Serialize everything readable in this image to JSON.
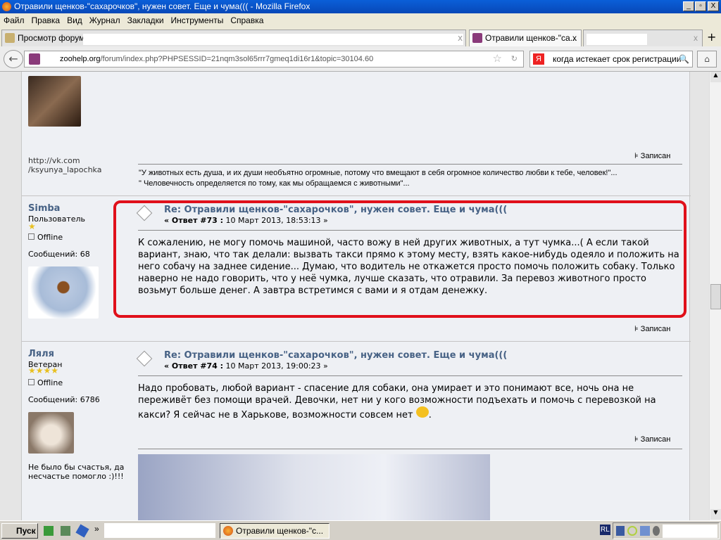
{
  "window": {
    "title": "Отравили щенков-\"сахарочков\", нужен совет. Еще и чума((( - Mozilla Firefox",
    "min": "_",
    "max": "▫",
    "close": "X"
  },
  "menu": [
    "Файл",
    "Правка",
    "Вид",
    "Журнал",
    "Закладки",
    "Инструменты",
    "Справка"
  ],
  "tabs": [
    {
      "label": "Просмотр форума"
    },
    {
      "label": "Отравили щенков-\"са..."
    }
  ],
  "tab_close": "x",
  "new_tab": "+",
  "nav": {
    "url_domain": "zoohelp.org",
    "url_path": "/forum/index.php?PHPSESSID=21nqm3sol65rrr7gmeq1di16r1&topic=30104.60",
    "search_engine": "Я",
    "search_value": "когда истекает срок регистрации"
  },
  "posts": [
    {
      "signature_link": "http://vk.com /ksyunya_lapochka",
      "saved": "Записан",
      "signature": [
        "\"У животных есть душа, и их души необъятно огромные, потому что вмещают в себя огромное количество любви к тебе, человек!\"...",
        "\" Человечность определяется по тому, как мы обращаемся с животными\"..."
      ]
    },
    {
      "user": "Simba",
      "rank": "Пользователь",
      "stars": 1,
      "status": "Offline",
      "count": "Сообщений: 68",
      "subject": "Re: Отравили щенков-\"сахарочков\", нужен совет. Еще и чума(((",
      "reply_label": "« Ответ #73 :",
      "date": "10 Март 2013, 18:53:13 »",
      "body": "К сожалению, не могу помочь машиной, часто вожу в ней других животных, а тут чумка...( А если такой вариант, знаю, что так делали: вызвать такси прямо к этому месту, взять какое-нибудь одеяло и положить на него собачу на заднее сидение... Думаю, что водитель не откажется просто помочь положить собаку. Только наверно не надо говорить, что у неё чумка, лучше сказать, что отравили. За перевоз животного просто возьмут больше денег. А завтра встретимся с вами и я отдам денежку.",
      "saved": "Записан"
    },
    {
      "user": "Ляля",
      "rank": "Ветеран",
      "stars": 4,
      "status": "Offline",
      "count": "Сообщений: 6786",
      "subject": "Re: Отравили щенков-\"сахарочков\", нужен совет. Еще и чума(((",
      "reply_label": "« Ответ #74 :",
      "date": "10 Март 2013, 19:00:23 »",
      "body": "Надо пробовать, любой вариант - спасение для собаки, она умирает и это понимают все, ночь она не переживёт без помощи врачей. Девочки, нет ни у кого возможности подъехать и помочь с перевозкой на какси? Я сейчас не в Харькове, возможности совсем нет",
      "body_end": ".",
      "saved": "Записан",
      "personal_text": "Не было бы счастья, да несчастье помогло :)!!!"
    }
  ],
  "taskbar": {
    "start": "Пуск",
    "chevron": "»",
    "task": "Отравили щенков-\"с...",
    "tray_lang": "RL"
  },
  "colors": {
    "highlight": "#e0101a",
    "title_blue": "#0a5fd8",
    "link": "#476285"
  }
}
